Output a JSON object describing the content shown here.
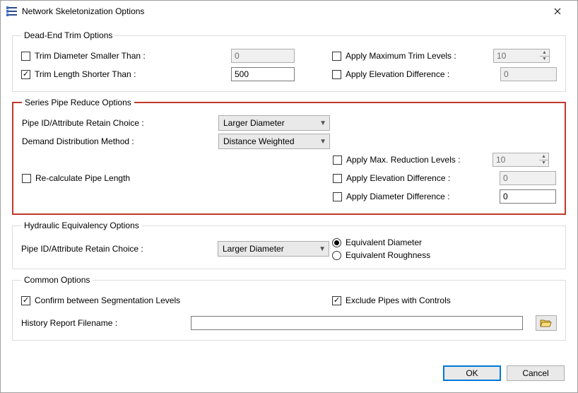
{
  "window": {
    "title": "Network Skeletonization Options"
  },
  "deadend": {
    "legend": "Dead-End Trim Options",
    "trim_diam_label": "Trim Diameter Smaller Than :",
    "trim_diam_value": "0",
    "trim_len_label": "Trim Length Shorter Than :",
    "trim_len_value": "500",
    "apply_max_trim_label": "Apply Maximum Trim Levels :",
    "apply_max_trim_value": "10",
    "apply_elev_diff_label": "Apply Elevation Difference :",
    "apply_elev_diff_value": "0"
  },
  "series": {
    "legend": "Series Pipe Reduce Options",
    "retain_label": "Pipe ID/Attribute Retain Choice :",
    "retain_value": "Larger Diameter",
    "demand_label": "Demand Distribution Method :",
    "demand_value": "Distance Weighted",
    "recalc_label": "Re-calculate Pipe Length",
    "apply_max_red_label": "Apply Max. Reduction Levels :",
    "apply_max_red_value": "10",
    "apply_elev_diff_label": "Apply Elevation Difference :",
    "apply_elev_diff_value": "0",
    "apply_diam_diff_label": "Apply Diameter Difference :",
    "apply_diam_diff_value": "0"
  },
  "hydraulic": {
    "legend": "Hydraulic Equivalency Options",
    "retain_label": "Pipe ID/Attribute Retain Choice :",
    "retain_value": "Larger Diameter",
    "eq_diam_label": "Equivalent Diameter",
    "eq_rough_label": "Equivalent Roughness"
  },
  "common": {
    "legend": "Common Options",
    "confirm_label": "Confirm between Segmentation Levels",
    "exclude_label": "Exclude Pipes with Controls",
    "history_label": "History Report Filename :",
    "history_value": ""
  },
  "buttons": {
    "ok": "OK",
    "cancel": "Cancel"
  }
}
